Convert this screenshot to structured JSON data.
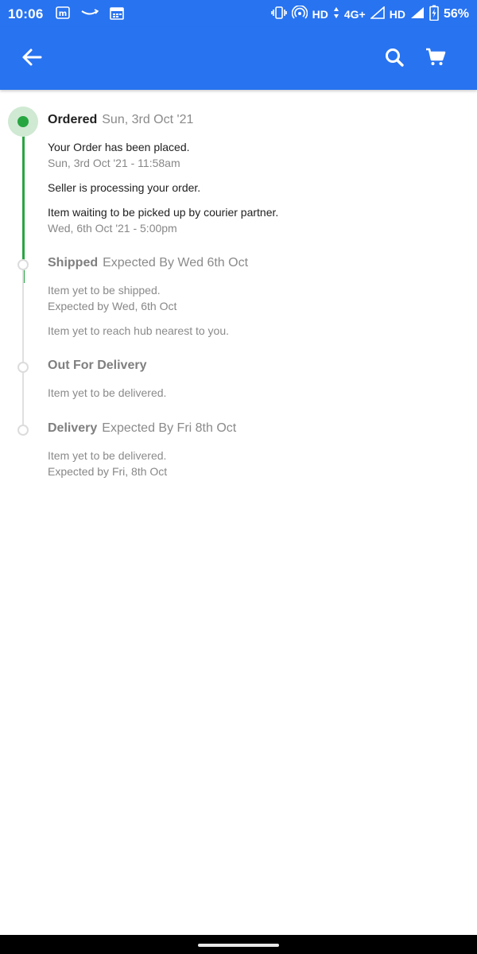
{
  "status_bar": {
    "time": "10:06",
    "network_label": "HD",
    "network_type": "4G+",
    "network_label_2": "HD",
    "battery_percent": "56%"
  },
  "app_bar": {
    "back_icon": "arrow-left-icon",
    "search_icon": "search-icon",
    "cart_icon": "cart-icon",
    "background_color": "#2874f0"
  },
  "timeline": {
    "active_color": "#26a541",
    "stages": [
      {
        "name": "Ordered",
        "subtitle": "Sun, 3rd Oct '21",
        "status": "done",
        "events": [
          {
            "text": "Your Order has been placed.",
            "time": "Sun, 3rd Oct '21 - 11:58am"
          },
          {
            "text": "Seller is processing your order.",
            "time": ""
          },
          {
            "text": "Item waiting to be picked up by courier partner.",
            "time": "Wed, 6th Oct '21 - 5:00pm"
          }
        ]
      },
      {
        "name": "Shipped",
        "subtitle": "Expected By Wed 6th Oct",
        "status": "pending",
        "events": [
          {
            "text": "Item yet to be shipped.",
            "time": "Expected by Wed, 6th Oct"
          },
          {
            "text": "Item yet to reach hub nearest to you.",
            "time": ""
          }
        ]
      },
      {
        "name": "Out For Delivery",
        "subtitle": "",
        "status": "pending",
        "events": [
          {
            "text": "Item yet to be delivered.",
            "time": ""
          }
        ]
      },
      {
        "name": "Delivery",
        "subtitle": "Expected By Fri 8th Oct",
        "status": "pending",
        "events": [
          {
            "text": "Item yet to be delivered.",
            "time": "Expected by Fri, 8th Oct"
          }
        ]
      }
    ]
  }
}
